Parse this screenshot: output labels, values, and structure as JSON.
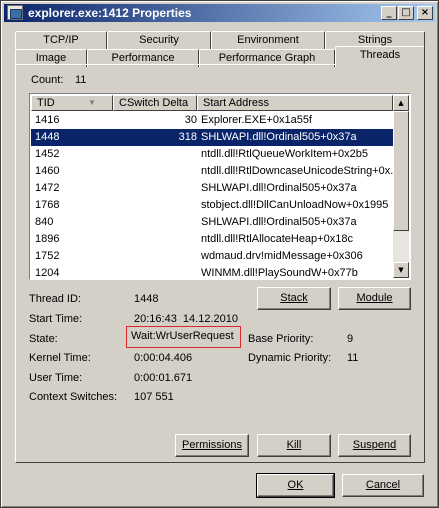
{
  "window": {
    "title": "explorer.exe:1412 Properties",
    "controls": [
      "_",
      "□",
      "×"
    ]
  },
  "tabs": {
    "row_back": [
      "TCP/IP",
      "Security",
      "Environment",
      "Strings"
    ],
    "row_front": [
      "Image",
      "Performance",
      "Performance Graph",
      "Threads"
    ],
    "active": "Threads"
  },
  "count": {
    "label": "Count:",
    "value": "11"
  },
  "table": {
    "columns": [
      "TID",
      "CSwitch Delta",
      "Start Address"
    ],
    "rows": [
      {
        "tid": "1416",
        "cswitch": "30",
        "address": "Explorer.EXE+0x1a55f"
      },
      {
        "tid": "1448",
        "cswitch": "318",
        "address": "SHLWAPI.dll!Ordinal505+0x37a",
        "selected": true
      },
      {
        "tid": "1452",
        "cswitch": "",
        "address": "ntdll.dll!RtlQueueWorkItem+0x2b5"
      },
      {
        "tid": "1460",
        "cswitch": "",
        "address": "ntdll.dll!RtlDowncaseUnicodeString+0x..."
      },
      {
        "tid": "1472",
        "cswitch": "",
        "address": "SHLWAPI.dll!Ordinal505+0x37a"
      },
      {
        "tid": "1768",
        "cswitch": "",
        "address": "stobject.dll!DllCanUnloadNow+0x1995"
      },
      {
        "tid": "840",
        "cswitch": "",
        "address": "SHLWAPI.dll!Ordinal505+0x37a"
      },
      {
        "tid": "1896",
        "cswitch": "",
        "address": "ntdll.dll!RtlAllocateHeap+0x18c"
      },
      {
        "tid": "1752",
        "cswitch": "",
        "address": "wdmaud.drv!midMessage+0x306"
      },
      {
        "tid": "1204",
        "cswitch": "",
        "address": "WINMM.dll!PlaySoundW+0x77b"
      }
    ]
  },
  "details": {
    "thread_id_label": "Thread ID:",
    "thread_id": "1448",
    "start_time_label": "Start Time:",
    "start_time": "20:16:43  14.12.2010",
    "state_label": "State:",
    "state": "Wait:WrUserRequest",
    "base_priority_label": "Base Priority:",
    "base_priority": "9",
    "kernel_time_label": "Kernel Time:",
    "kernel_time": "0:00:04.406",
    "dynamic_priority_label": "Dynamic Priority:",
    "dynamic_priority": "11",
    "user_time_label": "User Time:",
    "user_time": "0:00:01.671",
    "context_switches_label": "Context Switches:",
    "context_switches": "107 551"
  },
  "buttons": {
    "stack": "Stack",
    "module": "Module",
    "permissions": "Permissions",
    "kill": "Kill",
    "suspend": "Suspend",
    "ok": "OK",
    "cancel": "Cancel"
  },
  "colors": {
    "selection": "#0a246a",
    "highlight_box": "#d9272e"
  }
}
